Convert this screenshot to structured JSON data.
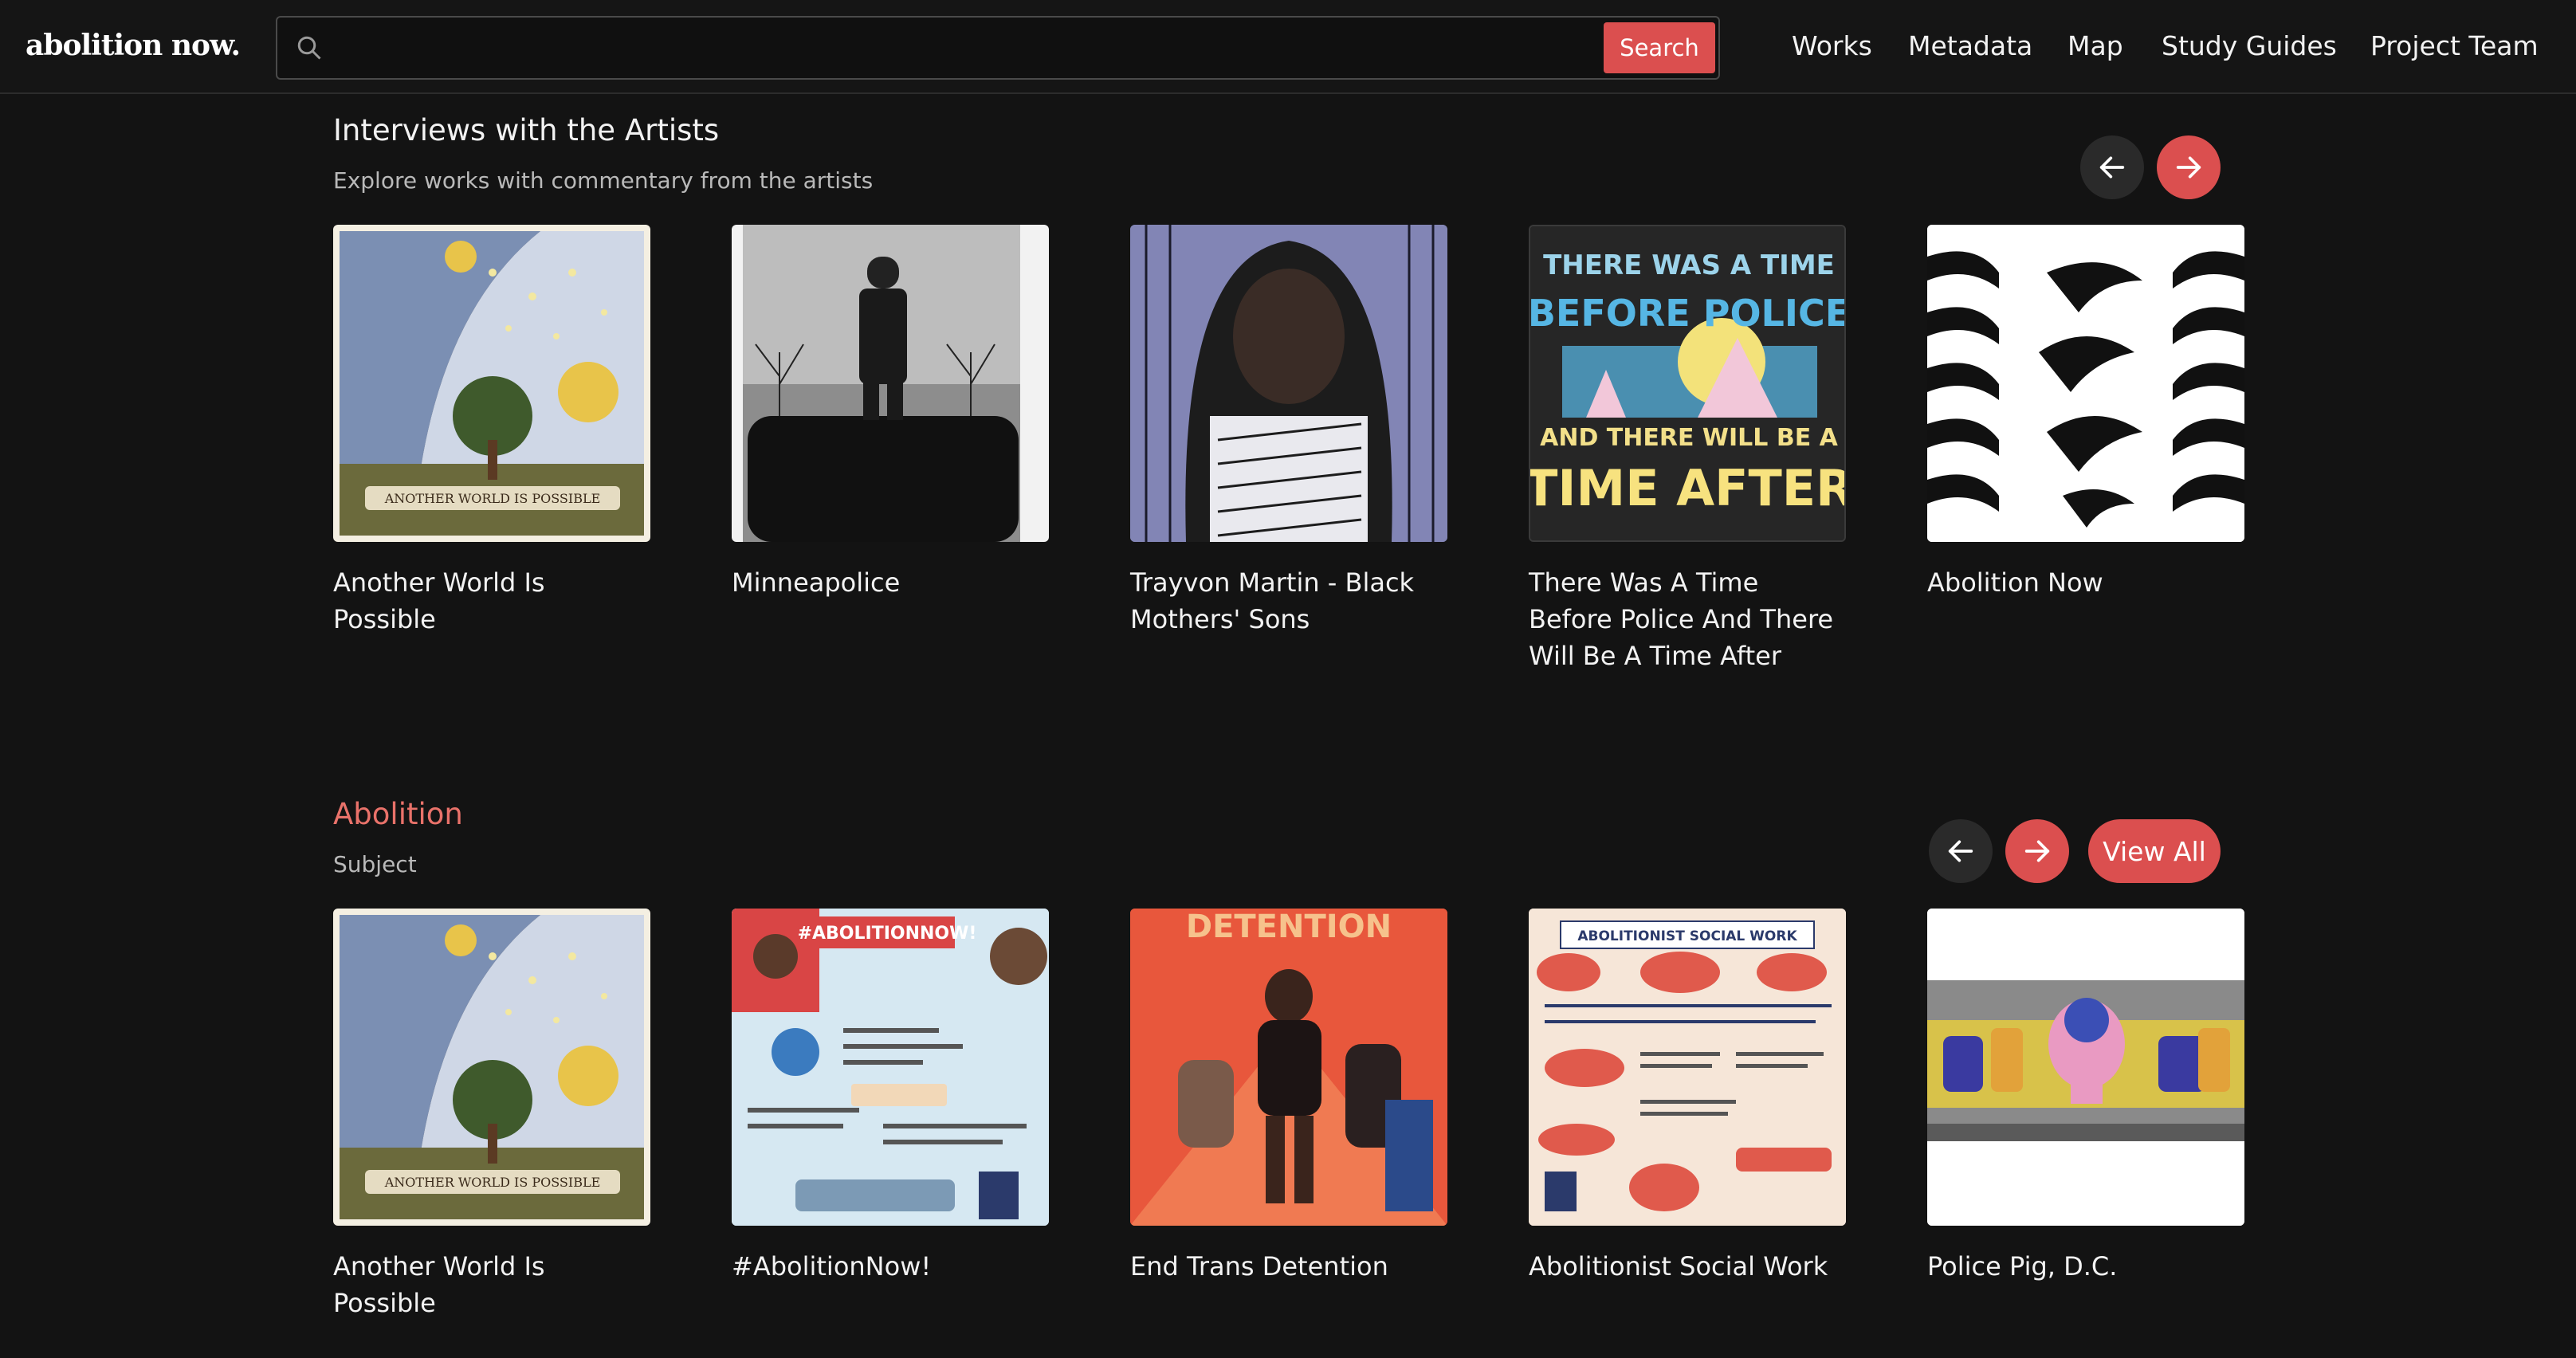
{
  "header": {
    "logo": "abolition now.",
    "search": {
      "placeholder": "",
      "button_label": "Search"
    },
    "nav": [
      "Works",
      "Metadata",
      "Map",
      "Study Guides",
      "Project Team"
    ]
  },
  "interviews": {
    "title": "Interviews with the Artists",
    "subtitle": "Explore works with commentary from the artists",
    "cards": [
      {
        "title": "Another World Is Possible",
        "thumb_text": "ANOTHER WORLD IS POSSIBLE"
      },
      {
        "title": "Minneapolice",
        "thumb_text": ""
      },
      {
        "title": "Trayvon Martin - Black Mothers' Sons",
        "thumb_text": ""
      },
      {
        "title": "There Was A Time Before Police And There Will Be A Time After",
        "thumb_text": ""
      },
      {
        "title": "Abolition Now",
        "thumb_text": ""
      }
    ]
  },
  "abolition": {
    "title": "Abolition",
    "subtitle": "Subject",
    "view_all_label": "View All",
    "cards": [
      {
        "title": "Another World Is Possible",
        "thumb_text": "ANOTHER WORLD IS POSSIBLE"
      },
      {
        "title": "#AbolitionNow!",
        "thumb_text": "#ABOLITIONNOW!"
      },
      {
        "title": "End Trans Detention",
        "thumb_text": "DETENTION"
      },
      {
        "title": "Abolitionist Social Work",
        "thumb_text": "ABOLITIONIST SOCIAL WORK"
      },
      {
        "title": "Police Pig, D.C.",
        "thumb_text": ""
      }
    ]
  },
  "art_text": {
    "there_was_1": "THERE WAS A TIME",
    "there_was_2": "BEFORE POLICE",
    "there_was_3": "AND THERE WILL BE A",
    "there_was_4": "TIME AFTER"
  },
  "colors": {
    "accent": "#db4f4f",
    "background": "#131313",
    "header": "#151515"
  },
  "icons": {
    "search": "search-icon",
    "prev": "arrow-left-icon",
    "next": "arrow-right-icon"
  }
}
